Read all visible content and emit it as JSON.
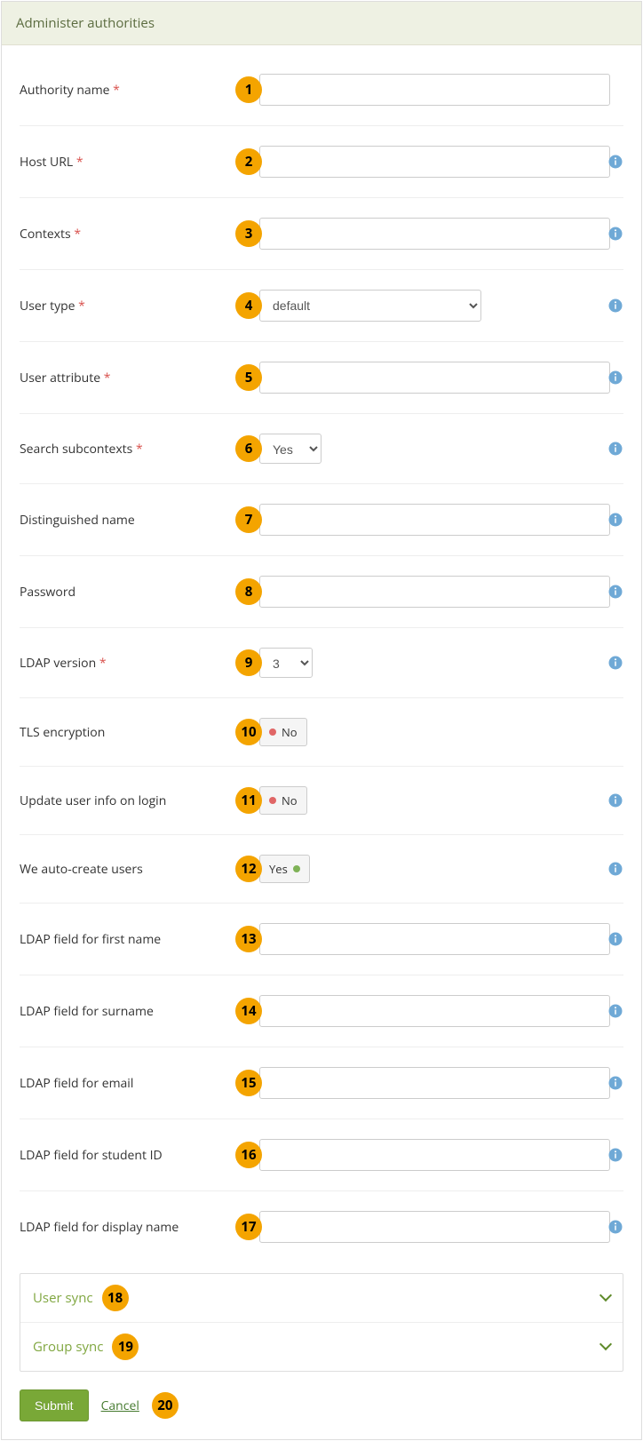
{
  "panel": {
    "title": "Administer authorities"
  },
  "fields": {
    "authority_name": {
      "label": "Authority name",
      "required": true,
      "badge": "1",
      "value": "",
      "info": false
    },
    "host_url": {
      "label": "Host URL",
      "required": true,
      "badge": "2",
      "value": "",
      "info": true
    },
    "contexts": {
      "label": "Contexts",
      "required": true,
      "badge": "3",
      "value": "",
      "info": true
    },
    "user_type": {
      "label": "User type",
      "required": true,
      "badge": "4",
      "selected": "default",
      "info": true
    },
    "user_attribute": {
      "label": "User attribute",
      "required": true,
      "badge": "5",
      "value": "",
      "info": true
    },
    "search_subcontexts": {
      "label": "Search subcontexts",
      "required": true,
      "badge": "6",
      "selected": "Yes",
      "info": true
    },
    "distinguished_name": {
      "label": "Distinguished name",
      "required": false,
      "badge": "7",
      "value": "",
      "info": true
    },
    "password": {
      "label": "Password",
      "required": false,
      "badge": "8",
      "value": "",
      "info": true
    },
    "ldap_version": {
      "label": "LDAP version",
      "required": true,
      "badge": "9",
      "selected": "3",
      "info": true
    },
    "tls_encryption": {
      "label": "TLS encryption",
      "required": false,
      "badge": "10",
      "state": "No",
      "info": false
    },
    "update_on_login": {
      "label": "Update user info on login",
      "required": false,
      "badge": "11",
      "state": "No",
      "info": true
    },
    "auto_create": {
      "label": "We auto-create users",
      "required": false,
      "badge": "12",
      "state": "Yes",
      "info": true
    },
    "field_firstname": {
      "label": "LDAP field for first name",
      "required": false,
      "badge": "13",
      "value": "",
      "info": true
    },
    "field_surname": {
      "label": "LDAP field for surname",
      "required": false,
      "badge": "14",
      "value": "",
      "info": true
    },
    "field_email": {
      "label": "LDAP field for email",
      "required": false,
      "badge": "15",
      "value": "",
      "info": true
    },
    "field_studentid": {
      "label": "LDAP field for student ID",
      "required": false,
      "badge": "16",
      "value": "",
      "info": true
    },
    "field_displayname": {
      "label": "LDAP field for display name",
      "required": false,
      "badge": "17",
      "value": "",
      "info": true
    }
  },
  "accordion": {
    "user_sync": {
      "label": "User sync",
      "badge": "18"
    },
    "group_sync": {
      "label": "Group sync",
      "badge": "19"
    }
  },
  "actions": {
    "submit": "Submit",
    "cancel": "Cancel",
    "badge": "20"
  }
}
